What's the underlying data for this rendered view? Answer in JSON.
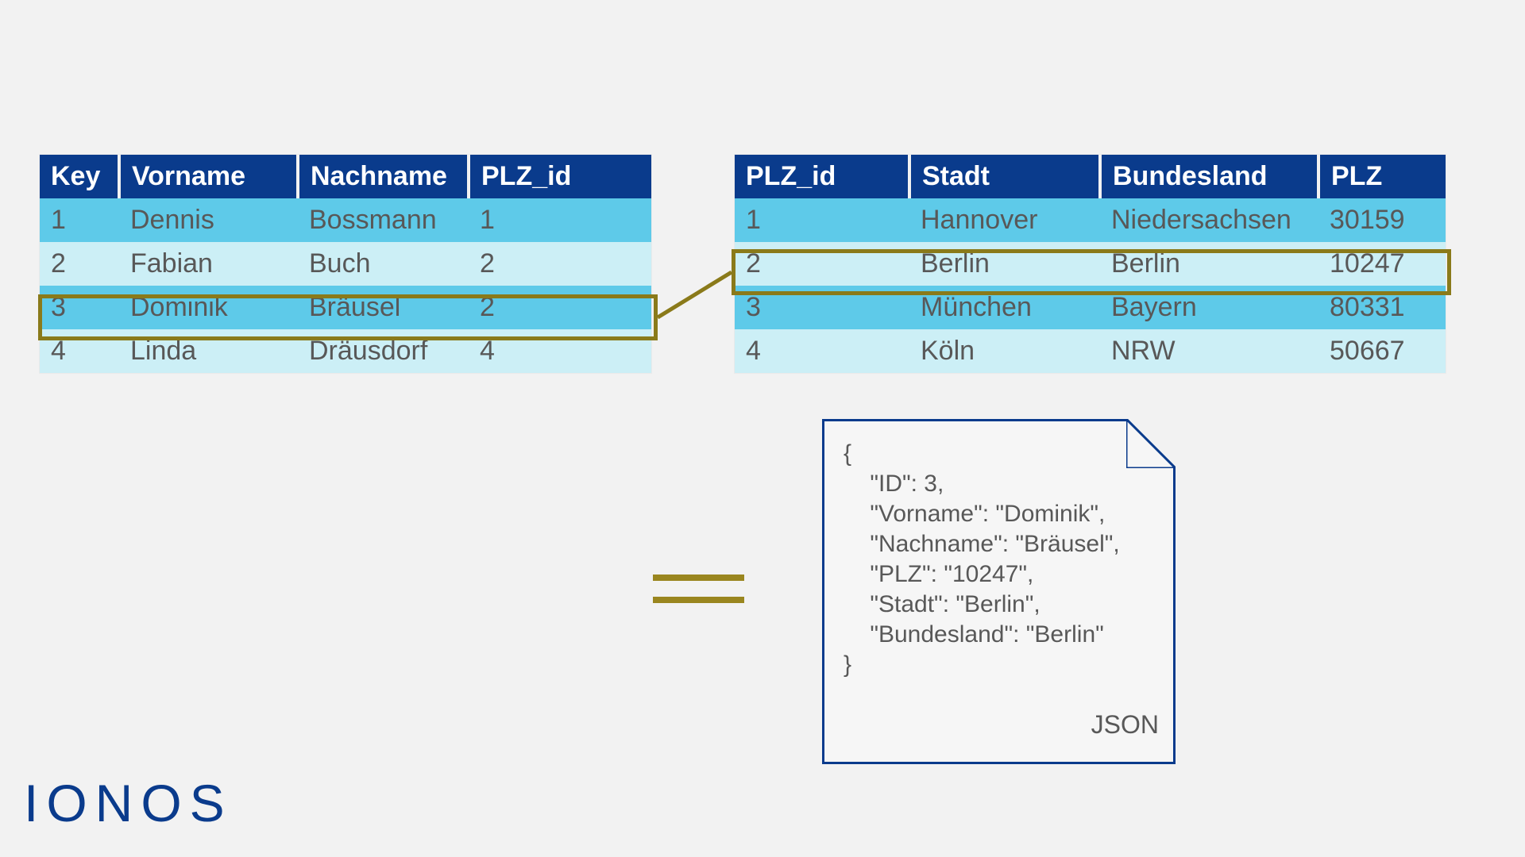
{
  "persons": {
    "headers": [
      "Key",
      "Vorname",
      "Nachname",
      "PLZ_id"
    ],
    "rows": [
      {
        "c": [
          "1",
          "Dennis",
          "Bossmann",
          "1"
        ]
      },
      {
        "c": [
          "2",
          "Fabian",
          "Buch",
          "2"
        ]
      },
      {
        "c": [
          "3",
          "Dominik",
          "Bräusel",
          "2"
        ]
      },
      {
        "c": [
          "4",
          "Linda",
          "Dräusdorf",
          "4"
        ]
      }
    ],
    "highlightedRowIndex": 2
  },
  "cities": {
    "headers": [
      "PLZ_id",
      "Stadt",
      "Bundesland",
      "PLZ"
    ],
    "rows": [
      {
        "c": [
          "1",
          "Hannover",
          "Niedersachsen",
          "30159"
        ]
      },
      {
        "c": [
          "2",
          "Berlin",
          "Berlin",
          "10247"
        ]
      },
      {
        "c": [
          "3",
          "München",
          "Bayern",
          "80331"
        ]
      },
      {
        "c": [
          "4",
          "Köln",
          "NRW",
          "50667"
        ]
      }
    ],
    "highlightedRowIndex": 1
  },
  "json_doc": {
    "lines": [
      "{",
      "    \"ID\": 3,",
      "    \"Vorname\": \"Dominik\",",
      "    \"Nachname\": \"Bräusel\",",
      "    \"PLZ\": \"10247\",",
      "    \"Stadt\": \"Berlin\",",
      "    \"Bundesland\": \"Berlin\"",
      "}"
    ],
    "label": "JSON"
  },
  "brand": "IONOS",
  "colors": {
    "header": "#0a3b8c",
    "row_dark": "#5ecae9",
    "row_light": "#cceff6",
    "highlight": "#8a7a1a"
  }
}
